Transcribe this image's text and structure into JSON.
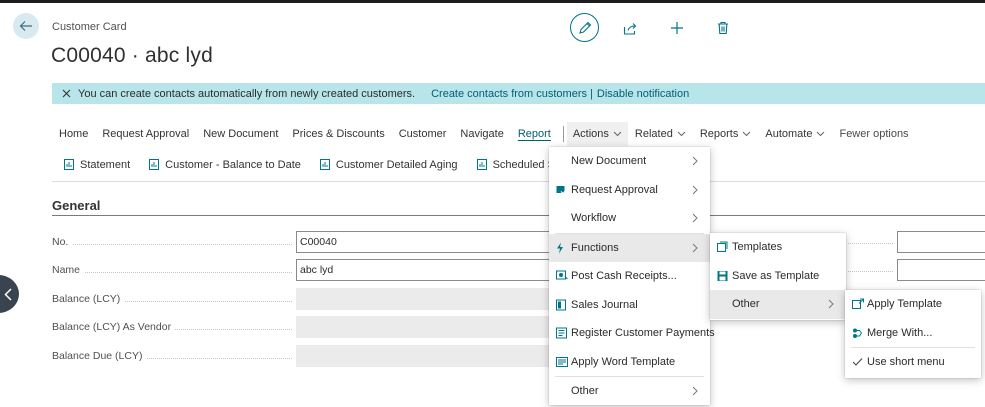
{
  "header": {
    "caption": "Customer Card",
    "title": "C00040 · abc lyd"
  },
  "notification": {
    "message": "You can create contacts automatically from newly created customers.",
    "link1": "Create contacts from customers |",
    "link2": "Disable notification"
  },
  "menubar": {
    "items": [
      "Home",
      "Request Approval",
      "New Document",
      "Prices & Discounts",
      "Customer",
      "Navigate",
      "Report"
    ],
    "actions": "Actions",
    "related": "Related",
    "reports": "Reports",
    "automate": "Automate",
    "fewer": "Fewer options"
  },
  "reportbar": {
    "items": [
      "Statement",
      "Customer - Balance to Date",
      "Customer Detailed Aging",
      "Scheduled Statements"
    ]
  },
  "general": {
    "heading": "General",
    "fields": [
      {
        "label": "No.",
        "value": "C00040"
      },
      {
        "label": "Name",
        "value": "abc lyd"
      },
      {
        "label": "Balance (LCY)",
        "value": ""
      },
      {
        "label": "Balance (LCY) As Vendor",
        "value": ""
      },
      {
        "label": "Balance Due (LCY)",
        "value": ""
      }
    ]
  },
  "actions_menu": {
    "items": [
      "New Document",
      "Request Approval",
      "Workflow",
      "Functions",
      "Post Cash Receipts...",
      "Sales Journal",
      "Register Customer Payments",
      "Apply Word Template",
      "Other"
    ]
  },
  "functions_menu": {
    "items": [
      "Templates",
      "Save as Template",
      "Other"
    ]
  },
  "other_menu": {
    "items": [
      "Apply Template",
      "Merge With...",
      "Use short menu"
    ]
  },
  "colors": {
    "accent": "#00758a",
    "notification_bg": "#b7e5ea",
    "link": "#005f73"
  }
}
